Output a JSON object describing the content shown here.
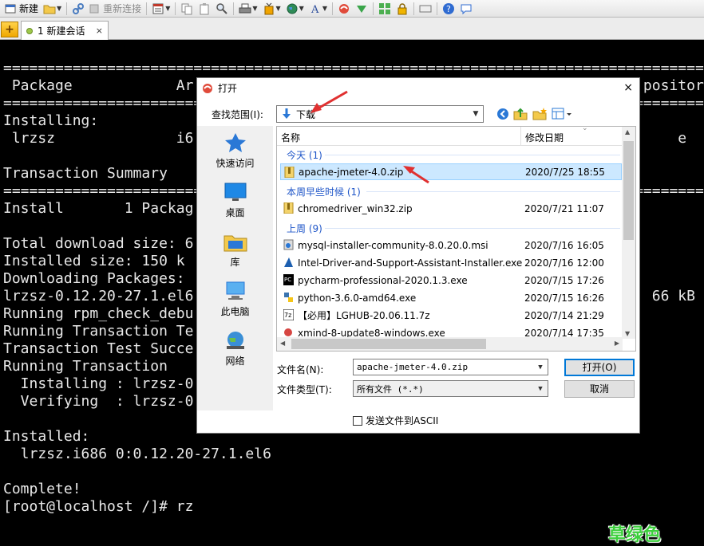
{
  "toolbar": {
    "new_label": "新建",
    "reconnect_label": "重新连接"
  },
  "tabs": {
    "add": "+",
    "session_label": "1 新建会话",
    "close": "×"
  },
  "terminal": {
    "lines": [
      "==================================================================================",
      " Package            Ar                                                    pository",
      "==================================================================================",
      "Installing:",
      " lrzsz              i6                                                        e",
      "",
      "Transaction Summary",
      "==================================================================================",
      "Install       1 Packag",
      "",
      "Total download size: 6",
      "Installed size: 150 k",
      "Downloading Packages:",
      "lrzsz-0.12.20-27.1.el6                                                     66 kB",
      "Running rpm_check_debu",
      "Running Transaction Te",
      "Transaction Test Succe",
      "Running Transaction",
      "  Installing : lrzsz-0",
      "  Verifying  : lrzsz-0",
      "",
      "Installed:",
      "  lrzsz.i686 0:0.12.20-27.1.el6",
      "",
      "Complete!",
      "[root@localhost /]# rz"
    ],
    "watermark": "草绿色"
  },
  "dialog": {
    "title": "打开",
    "close": "×",
    "lookin_label": "查找范围(I):",
    "lookin_value": "下载",
    "places": [
      "快速访问",
      "桌面",
      "库",
      "此电脑",
      "网络"
    ],
    "columns": {
      "name": "名称",
      "date": "修改日期"
    },
    "groups": [
      {
        "label": "今天 (1)",
        "files": [
          {
            "name": "apache-jmeter-4.0.zip",
            "date": "2020/7/25 18:55",
            "selected": true,
            "icon": "zip-icon"
          }
        ]
      },
      {
        "label": "本周早些时候 (1)",
        "files": [
          {
            "name": "chromedriver_win32.zip",
            "date": "2020/7/21 11:07",
            "icon": "zip-icon"
          }
        ]
      },
      {
        "label": "上周 (9)",
        "files": [
          {
            "name": "mysql-installer-community-8.0.20.0.msi",
            "date": "2020/7/16 16:05",
            "icon": "msi-icon"
          },
          {
            "name": "Intel-Driver-and-Support-Assistant-Installer.exe",
            "date": "2020/7/16 12:00",
            "icon": "intel-icon"
          },
          {
            "name": "pycharm-professional-2020.1.3.exe",
            "date": "2020/7/15 17:26",
            "icon": "pycharm-icon"
          },
          {
            "name": "python-3.6.0-amd64.exe",
            "date": "2020/7/15 16:26",
            "icon": "python-icon"
          },
          {
            "name": "【必用】LGHUB-20.06.11.7z",
            "date": "2020/7/14 21:29",
            "icon": "7z-icon"
          },
          {
            "name": "xmind-8-update8-windows.exe",
            "date": "2020/7/14 17:35",
            "icon": "xmind-icon"
          }
        ]
      }
    ],
    "filename_label": "文件名(N):",
    "filename_value": "apache-jmeter-4.0.zip",
    "filetype_label": "文件类型(T):",
    "filetype_value": "所有文件 (*.*)",
    "open_button": "打开(O)",
    "cancel_button": "取消",
    "ascii_label": "发送文件到ASCII"
  }
}
